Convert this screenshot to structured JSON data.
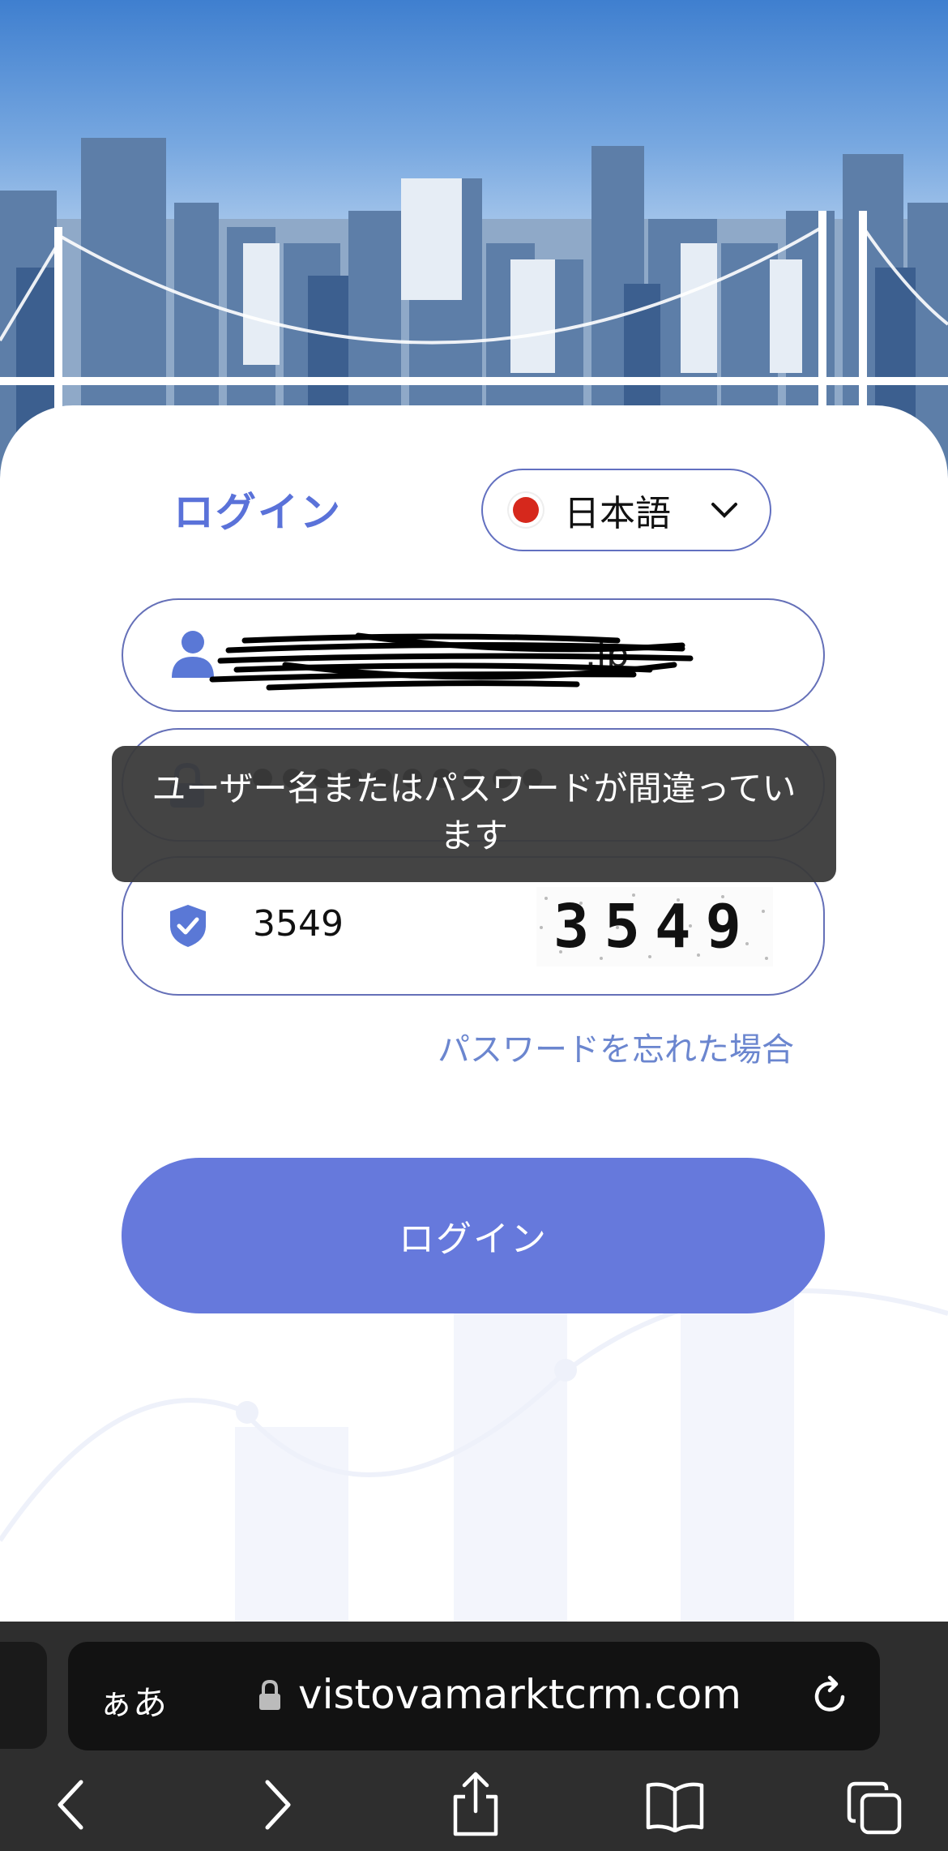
{
  "header": {
    "title": "ログイン"
  },
  "language": {
    "label": "日本語",
    "flag": "japan-flag"
  },
  "form": {
    "username_value": ".jp",
    "password_dots": 10,
    "captcha_value": "3549",
    "captcha_image_text": "3549"
  },
  "forgot_link": "パスワードを忘れた場合",
  "login_button": "ログイン",
  "toast": "ユーザー名またはパスワードが間違っています",
  "browser": {
    "text_size_label": "ぁあ",
    "url": "vistovamarktcrm.com"
  },
  "colors": {
    "accent": "#6679dc",
    "title": "#5a72d9",
    "link": "#6b86cf"
  }
}
